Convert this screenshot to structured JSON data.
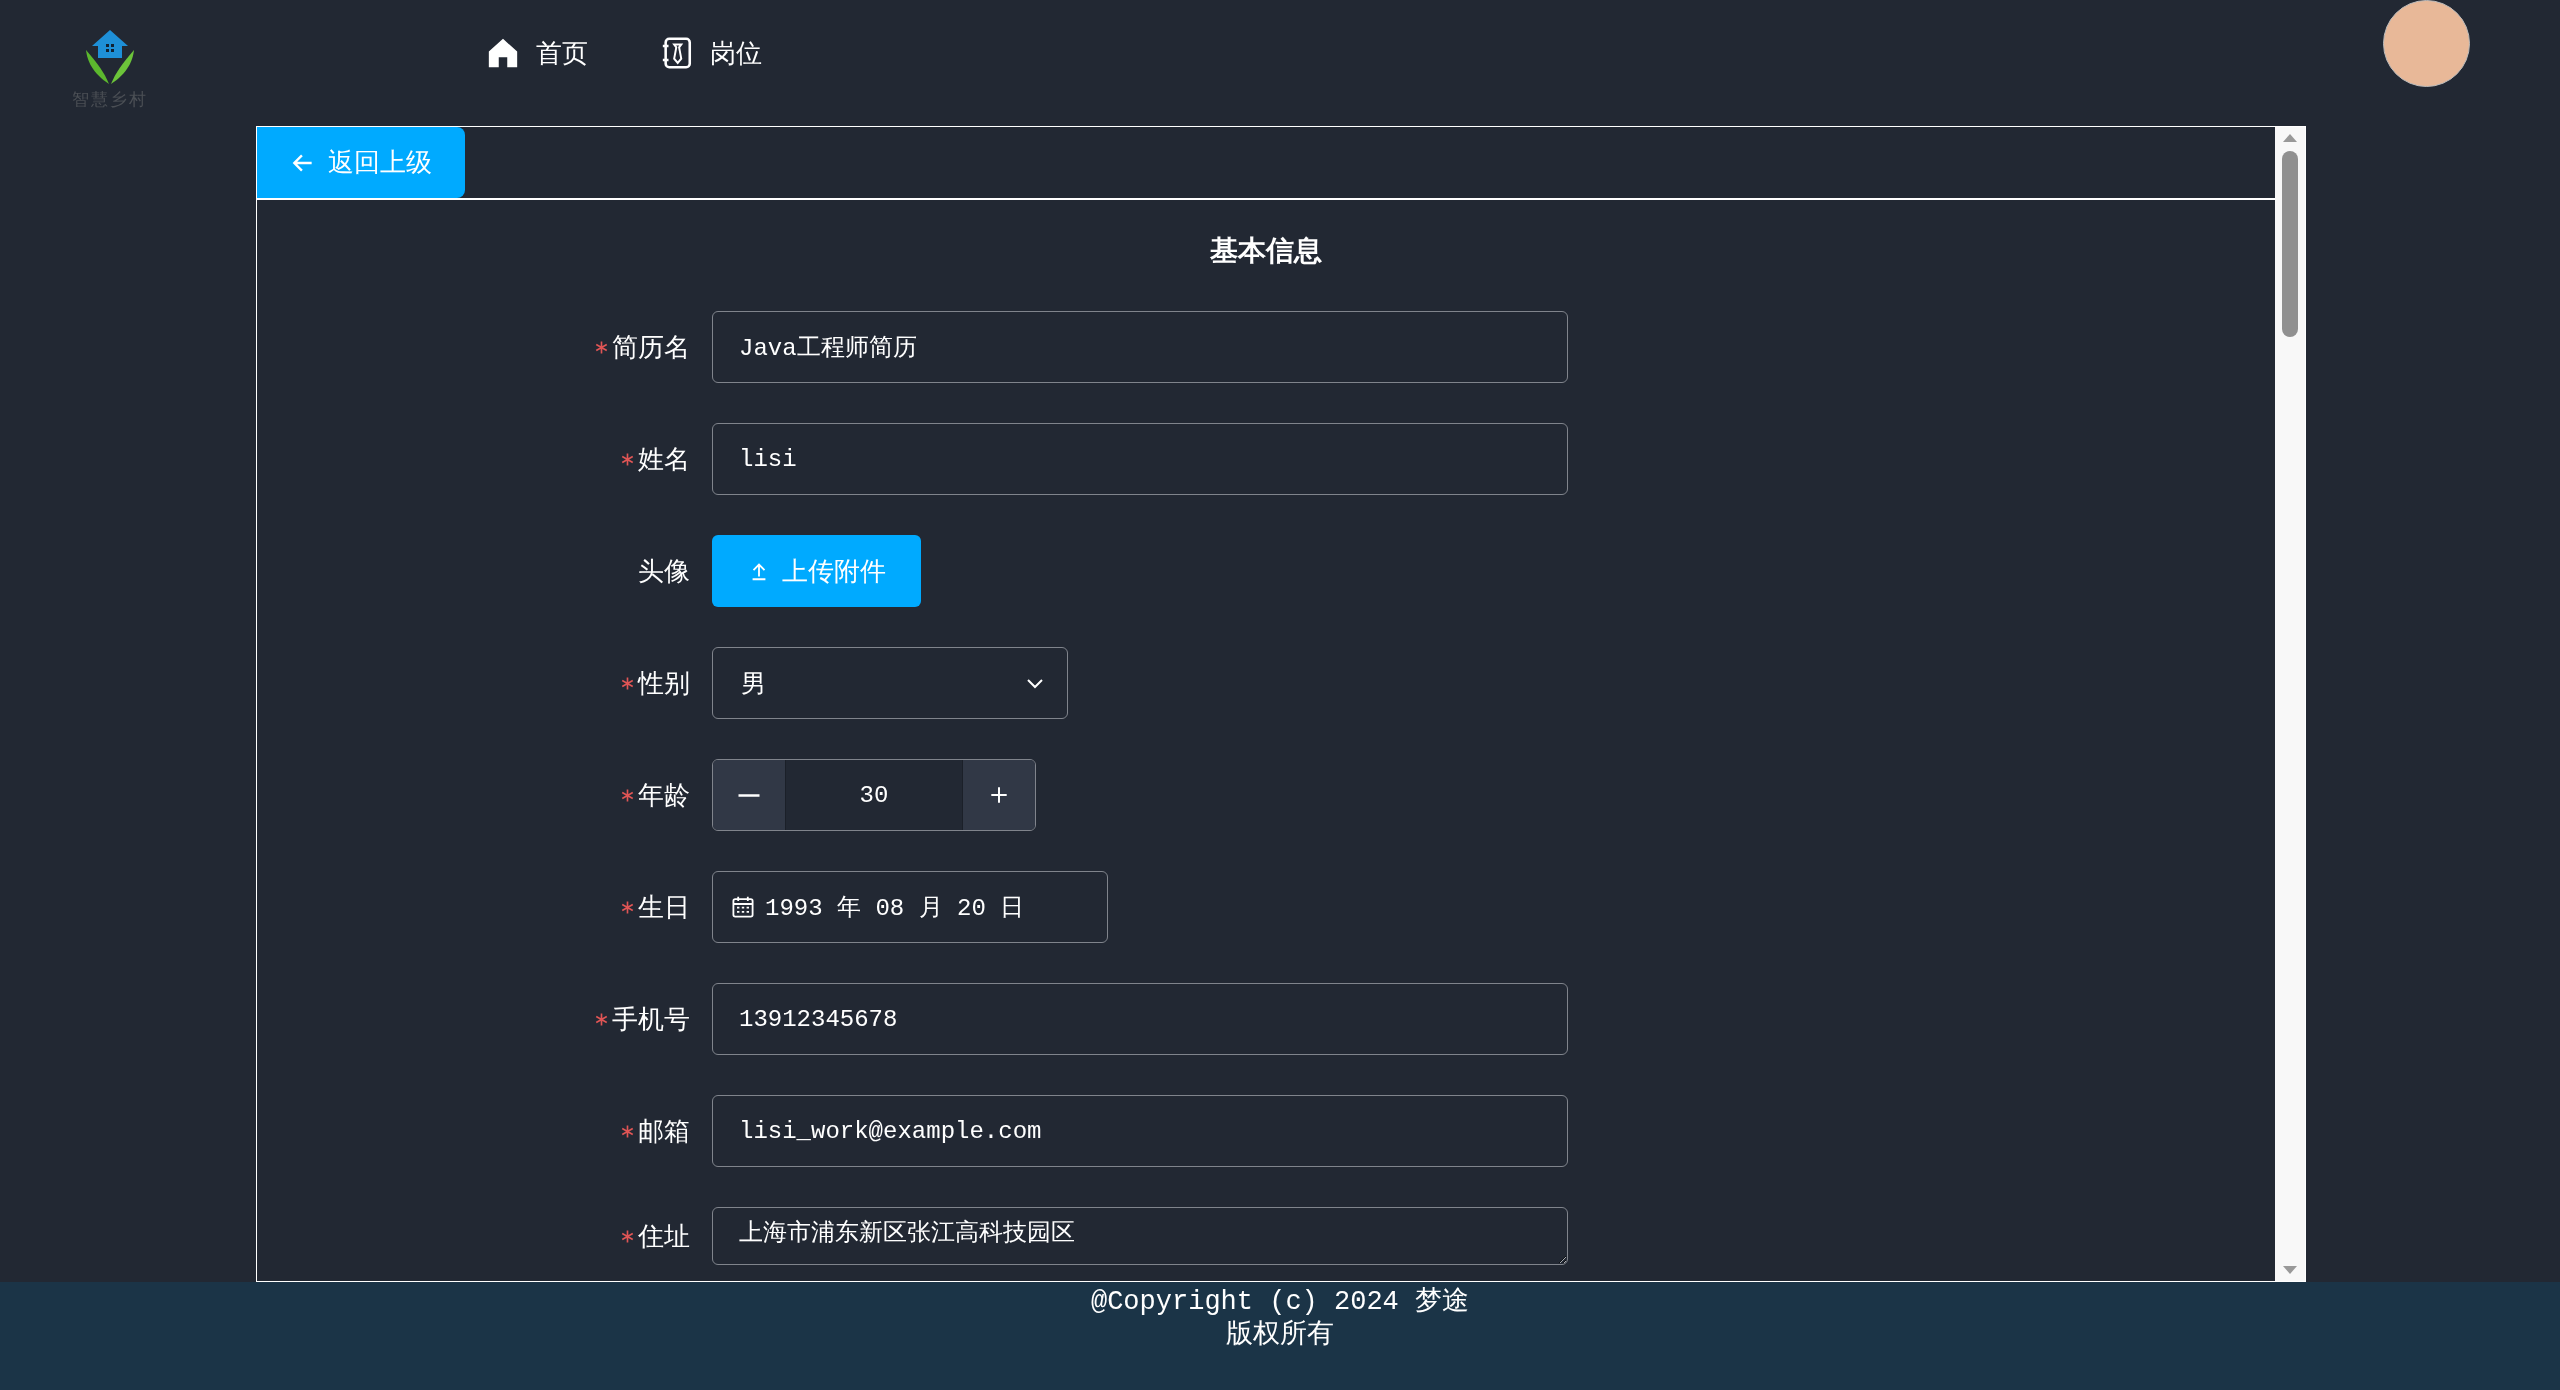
{
  "header": {
    "logo": {
      "text": "智慧乡村"
    },
    "nav": [
      {
        "label": "首页"
      },
      {
        "label": "岗位"
      }
    ]
  },
  "back_button": {
    "label": "返回上级"
  },
  "form": {
    "title": "基本信息",
    "fields": [
      {
        "kind": "text",
        "label": "简历名",
        "required": true,
        "value": "Java工程师简历"
      },
      {
        "kind": "text",
        "label": "姓名",
        "required": true,
        "value": "lisi"
      },
      {
        "kind": "upload",
        "label": "头像",
        "required": false,
        "button": "上传附件"
      },
      {
        "kind": "select",
        "label": "性别",
        "required": true,
        "value": "男"
      },
      {
        "kind": "number",
        "label": "年龄",
        "required": true,
        "value": "30"
      },
      {
        "kind": "date",
        "label": "生日",
        "required": true,
        "value": "1993 年 08 月 20 日"
      },
      {
        "kind": "text",
        "label": "手机号",
        "required": true,
        "value": "13912345678"
      },
      {
        "kind": "text",
        "label": "邮箱",
        "required": true,
        "value": "lisi_work@example.com"
      },
      {
        "kind": "textarea",
        "label": "住址",
        "required": true,
        "value": "上海市浦东新区张江高科技园区"
      }
    ]
  },
  "footer": {
    "lines": [
      "@Copyright (c) 2024 梦途",
      "版权所有"
    ]
  }
}
